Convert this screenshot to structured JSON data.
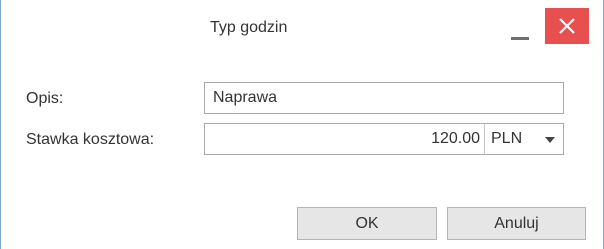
{
  "dialog": {
    "title": "Typ godzin",
    "minimize_icon": "minimize-icon",
    "close_icon": "close-icon",
    "close_color": "#e8504f"
  },
  "form": {
    "description_label": "Opis:",
    "description_value": "Naprawa",
    "cost_rate_label": "Stawka kosztowa:",
    "cost_rate_value": "120.00",
    "currency_value": "PLN"
  },
  "buttons": {
    "ok_label": "OK",
    "cancel_label": "Anuluj"
  }
}
